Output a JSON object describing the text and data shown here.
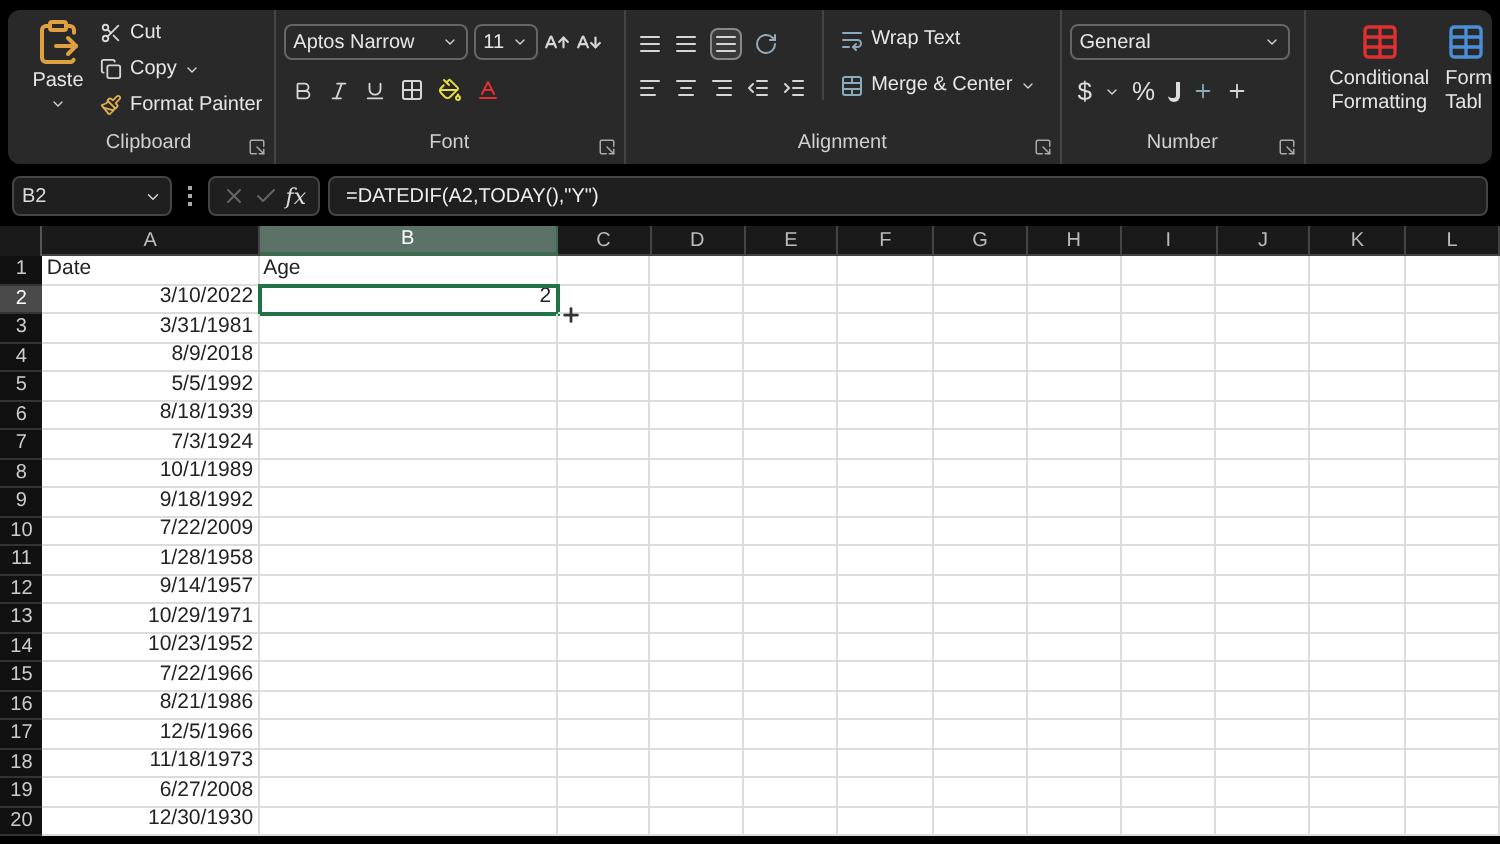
{
  "ribbon": {
    "clipboard": {
      "title": "Clipboard",
      "paste": "Paste",
      "cut": "Cut",
      "copy": "Copy",
      "format_painter": "Format Painter"
    },
    "font": {
      "title": "Font",
      "font_name": "Aptos Narrow",
      "font_size": "11"
    },
    "alignment": {
      "title": "Alignment",
      "wrap_text": "Wrap Text",
      "merge_center": "Merge & Center",
      "middle_align_selected": true
    },
    "number": {
      "title": "Number",
      "format": "General",
      "currency": "$",
      "percent": "%"
    },
    "styles": {
      "conditional_formatting": [
        "Conditional",
        "Formatting"
      ],
      "format_as_table": [
        "Form",
        "Tabl"
      ]
    }
  },
  "formula_bar": {
    "name_box": "B2",
    "insert_function": "fx",
    "formula": "=DATEDIF(A2,TODAY(),\"Y\")"
  },
  "sheet": {
    "columns": [
      {
        "label": "A",
        "selected": false
      },
      {
        "label": "B",
        "selected": true
      },
      {
        "label": "C",
        "selected": false
      },
      {
        "label": "D",
        "selected": false
      },
      {
        "label": "E",
        "selected": false
      },
      {
        "label": "F",
        "selected": false
      },
      {
        "label": "G",
        "selected": false
      },
      {
        "label": "H",
        "selected": false
      },
      {
        "label": "I",
        "selected": false
      },
      {
        "label": "J",
        "selected": false
      },
      {
        "label": "K",
        "selected": false
      },
      {
        "label": "L",
        "selected": false
      }
    ],
    "rows": [
      {
        "header": "1",
        "selected": false,
        "cells": [
          {
            "text": "Date",
            "active": false
          },
          {
            "text": "Age",
            "active": false
          }
        ]
      },
      {
        "header": "2",
        "selected": true,
        "cells": [
          {
            "text": "3/10/2022",
            "active": false
          },
          {
            "text": "2",
            "active": true
          }
        ]
      },
      {
        "header": "3",
        "selected": false,
        "cells": [
          {
            "text": "3/31/1981",
            "active": false
          }
        ]
      },
      {
        "header": "4",
        "selected": false,
        "cells": [
          {
            "text": "8/9/2018",
            "active": false
          }
        ]
      },
      {
        "header": "5",
        "selected": false,
        "cells": [
          {
            "text": "5/5/1992",
            "active": false
          }
        ]
      },
      {
        "header": "6",
        "selected": false,
        "cells": [
          {
            "text": "8/18/1939",
            "active": false
          }
        ]
      },
      {
        "header": "7",
        "selected": false,
        "cells": [
          {
            "text": "7/3/1924",
            "active": false
          }
        ]
      },
      {
        "header": "8",
        "selected": false,
        "cells": [
          {
            "text": "10/1/1989",
            "active": false
          }
        ]
      },
      {
        "header": "9",
        "selected": false,
        "cells": [
          {
            "text": "9/18/1992",
            "active": false
          }
        ]
      },
      {
        "header": "10",
        "selected": false,
        "cells": [
          {
            "text": "7/22/2009",
            "active": false
          }
        ]
      },
      {
        "header": "11",
        "selected": false,
        "cells": [
          {
            "text": "1/28/1958",
            "active": false
          }
        ]
      },
      {
        "header": "12",
        "selected": false,
        "cells": [
          {
            "text": "9/14/1957",
            "active": false
          }
        ]
      },
      {
        "header": "13",
        "selected": false,
        "cells": [
          {
            "text": "10/29/1971",
            "active": false
          }
        ]
      },
      {
        "header": "14",
        "selected": false,
        "cells": [
          {
            "text": "10/23/1952",
            "active": false
          }
        ]
      },
      {
        "header": "15",
        "selected": false,
        "cells": [
          {
            "text": "7/22/1966",
            "active": false
          }
        ]
      },
      {
        "header": "16",
        "selected": false,
        "cells": [
          {
            "text": "8/21/1986",
            "active": false
          }
        ]
      },
      {
        "header": "17",
        "selected": false,
        "cells": [
          {
            "text": "12/5/1966",
            "active": false
          }
        ]
      },
      {
        "header": "18",
        "selected": false,
        "cells": [
          {
            "text": "11/18/1973",
            "active": false
          }
        ]
      },
      {
        "header": "19",
        "selected": false,
        "cells": [
          {
            "text": "6/27/2008",
            "active": false
          }
        ]
      },
      {
        "header": "20",
        "selected": false,
        "cells": [
          {
            "text": "12/30/1930",
            "active": false
          }
        ]
      }
    ]
  }
}
